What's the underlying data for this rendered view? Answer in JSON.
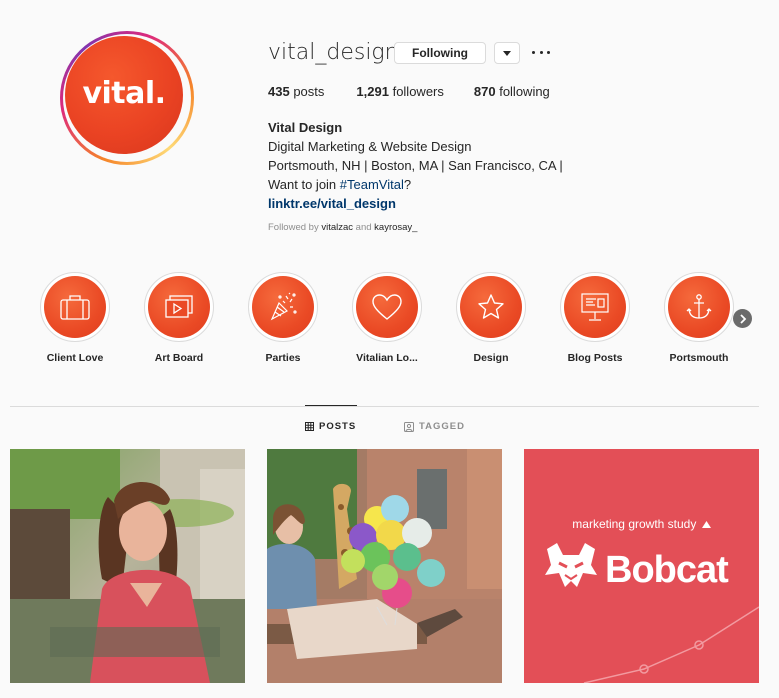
{
  "profile": {
    "avatar_text": "vital.",
    "username": "vital_design",
    "follow_button": "Following",
    "stats": {
      "posts_count": "435",
      "posts_label": "posts",
      "followers_count": "1,291",
      "followers_label": "followers",
      "following_count": "870",
      "following_label": "following"
    },
    "bio": {
      "name": "Vital Design",
      "line1": "Digital Marketing & Website Design",
      "line2": "Portsmouth, NH | Boston, MA | San Francisco, CA |",
      "line3_prefix": "Want to join ",
      "hashtag": "#TeamVital",
      "line3_suffix": "?",
      "link": "linktr.ee/vital_design"
    },
    "followed_by": {
      "prefix": "Followed by ",
      "user1": "vitalzac",
      "joiner": " and ",
      "user2": "kayrosay_"
    }
  },
  "highlights": [
    {
      "label": "Client Love",
      "icon": "briefcase-icon"
    },
    {
      "label": "Art Board",
      "icon": "slideshow-icon"
    },
    {
      "label": "Parties",
      "icon": "party-hat-icon"
    },
    {
      "label": "Vitalian Lo...",
      "icon": "heart-icon"
    },
    {
      "label": "Design",
      "icon": "star-icon"
    },
    {
      "label": "Blog Posts",
      "icon": "presentation-board-icon"
    },
    {
      "label": "Portsmouth",
      "icon": "anchor-icon"
    }
  ],
  "tabs": {
    "posts": "POSTS",
    "tagged": "TAGGED"
  },
  "posts": [
    {
      "caption": ""
    },
    {
      "caption": ""
    },
    {
      "study_label": "marketing growth study",
      "brand": "Bobcat"
    }
  ],
  "colors": {
    "brand_orange": "#ea4323",
    "link_blue": "#00376b",
    "bobcat_red": "#e34f57"
  }
}
